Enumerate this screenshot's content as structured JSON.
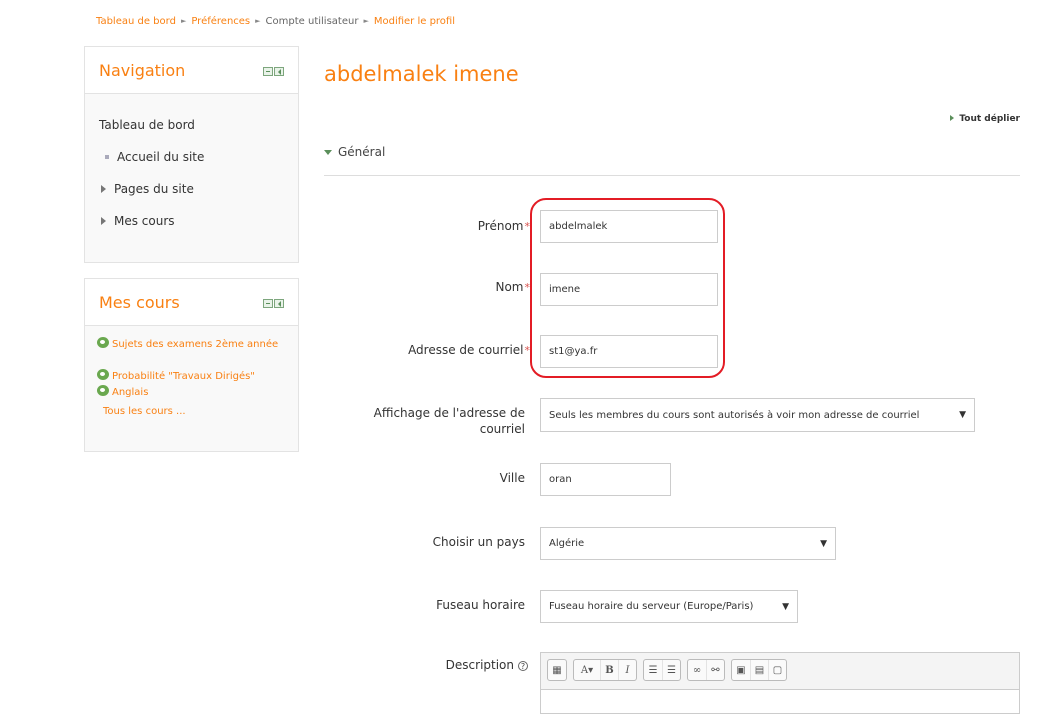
{
  "breadcrumb": [
    "Tableau de bord",
    "Préférences",
    "Compte utilisateur",
    "Modifier le profil"
  ],
  "navigation": {
    "title": "Navigation",
    "items": [
      "Tableau de bord",
      "Accueil du site",
      "Pages du site",
      "Mes cours"
    ]
  },
  "mycourses": {
    "title": "Mes cours",
    "items": [
      "Sujets des examens 2ème année",
      "Probabilité \"Travaux Dirigés\"",
      "Anglais"
    ],
    "all": "Tous les cours ..."
  },
  "page": {
    "title": "abdelmalek imene",
    "expand_all": "Tout déplier",
    "section": "Général"
  },
  "form": {
    "firstname": {
      "label": "Prénom",
      "value": "abdelmalek"
    },
    "lastname": {
      "label": "Nom",
      "value": "imene"
    },
    "email": {
      "label": "Adresse de courriel",
      "value": "st1@ya.fr"
    },
    "maildisplay": {
      "label": "Affichage de l'adresse de courriel",
      "value": "Seuls les membres du cours sont autorisés à voir mon adresse de courriel"
    },
    "city": {
      "label": "Ville",
      "value": "oran"
    },
    "country": {
      "label": "Choisir un pays",
      "value": "Algérie"
    },
    "timezone": {
      "label": "Fuseau horaire",
      "value": "Fuseau horaire du serveur (Europe/Paris)"
    },
    "description": {
      "label": "Description"
    }
  },
  "required_marker": "*",
  "help_glyph": "?",
  "accent_color": "#f98012",
  "highlight_color": "#e31c25"
}
